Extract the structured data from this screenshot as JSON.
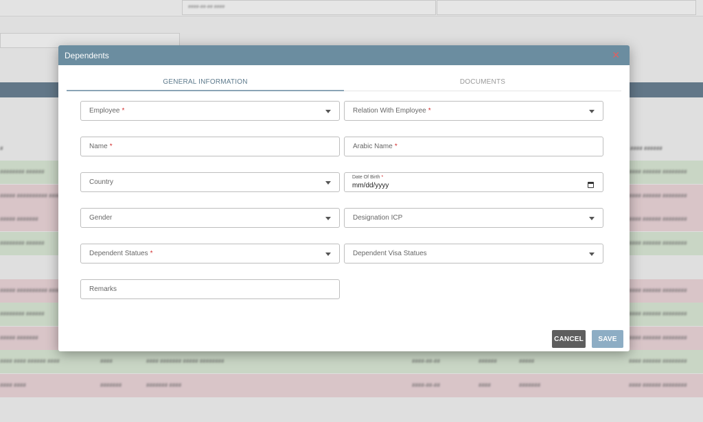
{
  "background": {
    "top_field_text": "####-##-## ####",
    "column_headers": [
      "#",
      "#### ######"
    ],
    "rows": [
      {
        "tone": "green",
        "cells": [
          "######## ######",
          "",
          "",
          "",
          "",
          "",
          "#### ###### ########"
        ]
      },
      {
        "tone": "red",
        "cells": [
          "##### ########## ####",
          "",
          "",
          "",
          "",
          "",
          "#### ###### ########"
        ]
      },
      {
        "tone": "red",
        "cells": [
          "##### #######",
          "",
          "",
          "",
          "",
          "",
          "#### ###### ########"
        ]
      },
      {
        "tone": "green",
        "cells": [
          "######## ######",
          "",
          "",
          "",
          "",
          "",
          "#### ###### ########"
        ]
      },
      {
        "tone": "plain",
        "cells": [
          "",
          "",
          "",
          "",
          "",
          "",
          ""
        ]
      },
      {
        "tone": "red",
        "cells": [
          "##### ########## ####",
          "",
          "",
          "",
          "",
          "",
          "#### ###### ########"
        ]
      },
      {
        "tone": "green",
        "cells": [
          "######## ######",
          "",
          "",
          "",
          "",
          "",
          "#### ###### ########"
        ]
      },
      {
        "tone": "red",
        "cells": [
          "##### #######",
          "",
          "",
          "",
          "",
          "",
          "#### ###### ########"
        ]
      },
      {
        "tone": "green",
        "cells": [
          "#### #### ###### ####",
          "####",
          "#### ####### ##### ########",
          "####-##-##",
          "######",
          "#####",
          "#### ###### ########"
        ]
      },
      {
        "tone": "red",
        "cells": [
          "#### ####",
          "#######",
          "####### ####",
          "####-##-##",
          "####",
          "#######",
          "#### ###### ########"
        ]
      }
    ]
  },
  "modal": {
    "title": "Dependents",
    "close_glyph": "✕",
    "tabs": [
      {
        "label": "GENERAL INFORMATION",
        "active": true
      },
      {
        "label": "DOCUMENTS",
        "active": false
      }
    ],
    "fields": {
      "employee": {
        "label": "Employee",
        "required": "*"
      },
      "relation": {
        "label": "Relation With Employee",
        "required": "*"
      },
      "name": {
        "label": "Name",
        "required": "*"
      },
      "arabic_name": {
        "label": "Arabic Name",
        "required": "*"
      },
      "country": {
        "label": "Country"
      },
      "dob": {
        "label": "Date Of Birth",
        "required": "*",
        "value": "mm/dd/yyyy"
      },
      "gender": {
        "label": "Gender"
      },
      "designation": {
        "label": "Designation ICP"
      },
      "dependent_status": {
        "label": "Dependent Statues",
        "required": "*"
      },
      "visa_status": {
        "label": "Dependent Visa Statues"
      },
      "remarks": {
        "label": "Remarks"
      }
    },
    "buttons": {
      "cancel": "CANCEL",
      "save": "SAVE"
    }
  },
  "colors": {
    "header": "#6b8da0",
    "save": "#8dadc4",
    "cancel": "#5e5e5e",
    "required": "#d32f2f",
    "row_green": "#dbe9d6",
    "row_red": "#ecd6da"
  }
}
